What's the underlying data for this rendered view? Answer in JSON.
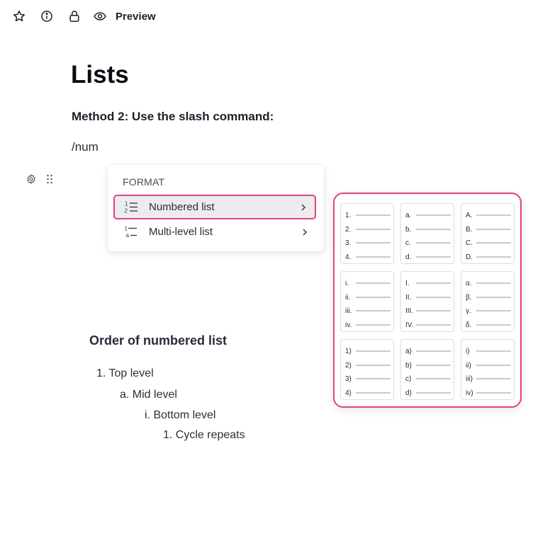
{
  "toolbar": {
    "preview_label": "Preview",
    "icons": [
      "star-icon",
      "info-icon",
      "lock-icon",
      "eye-icon"
    ]
  },
  "doc": {
    "title": "Lists",
    "method": "Method 2: Use the slash command:",
    "slash_text": "/num"
  },
  "slash_menu": {
    "heading": "FORMAT",
    "items": [
      {
        "label": "Numbered list",
        "selected": true,
        "icon": "numbered-list-icon"
      },
      {
        "label": "Multi-level list",
        "selected": false,
        "icon": "multilevel-list-icon"
      }
    ]
  },
  "format_grid": {
    "highlight_color": "#e0457b",
    "cells": [
      [
        "1.",
        "2.",
        "3.",
        "4."
      ],
      [
        "a.",
        "b.",
        "c.",
        "d."
      ],
      [
        "A.",
        "B.",
        "C.",
        "D."
      ],
      [
        "i.",
        "ii.",
        "iii.",
        "iv."
      ],
      [
        "I.",
        "II.",
        "III.",
        "IV."
      ],
      [
        "α.",
        "β.",
        "γ.",
        "δ."
      ],
      [
        "1)",
        "2)",
        "3)",
        "4)"
      ],
      [
        "a)",
        "b)",
        "c)",
        "d)"
      ],
      [
        "i)",
        "ii)",
        "iii)",
        "iv)"
      ]
    ]
  },
  "order": {
    "title": "Order of numbered list",
    "levels": [
      "1. Top level",
      "a. Mid level",
      "i. Bottom level",
      "1. Cycle repeats"
    ]
  }
}
